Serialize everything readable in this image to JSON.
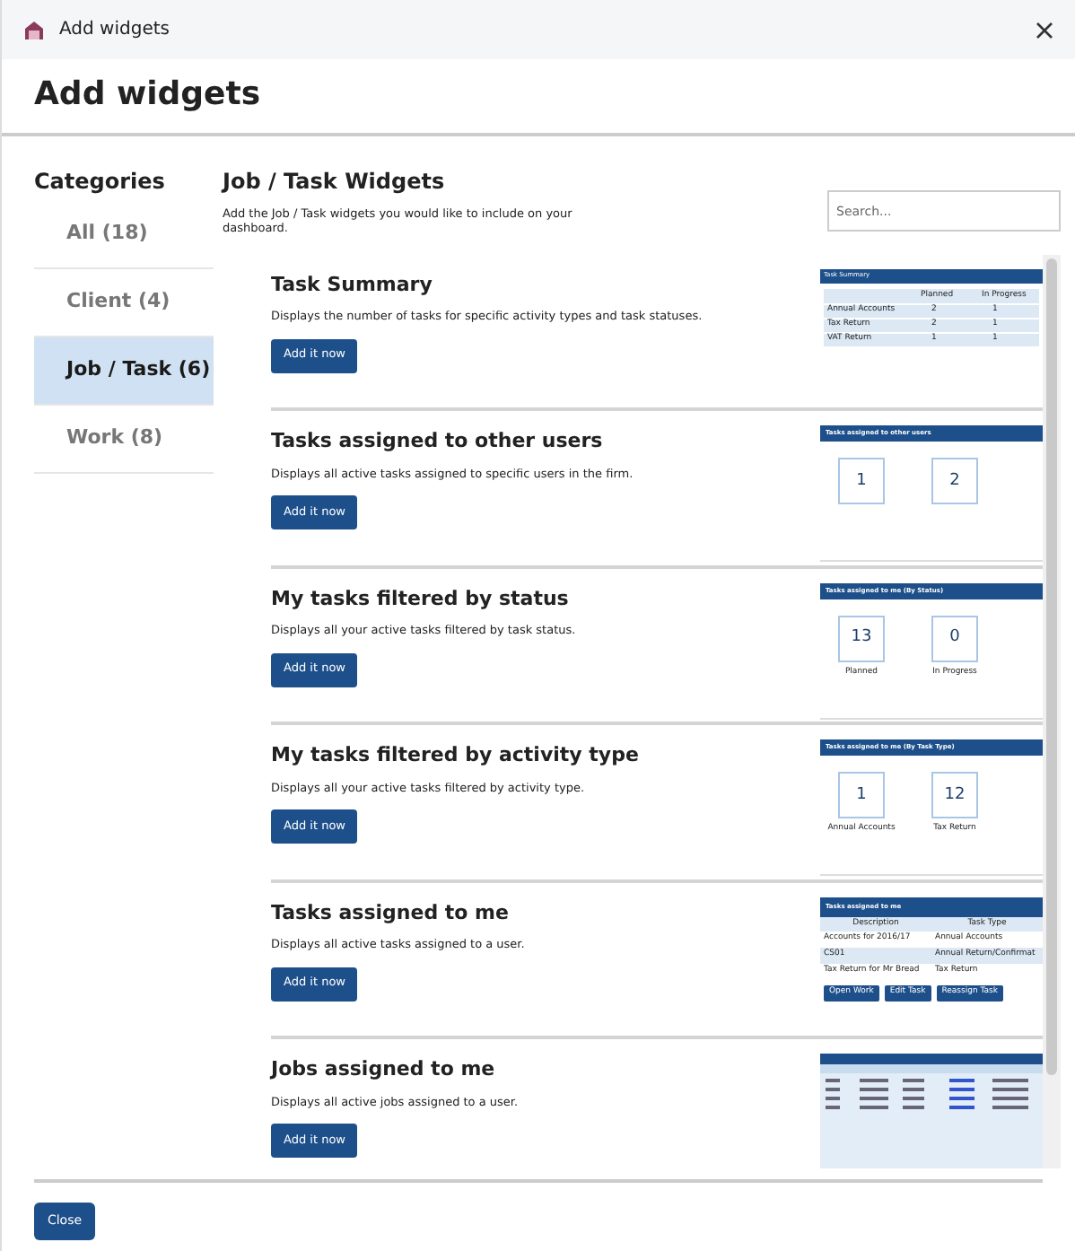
{
  "window": {
    "title": "Add widgets"
  },
  "heading": "Add widgets",
  "sidebar": {
    "title": "Categories",
    "items": [
      {
        "label": "All (18)",
        "selected": false
      },
      {
        "label": "Client (4)",
        "selected": false
      },
      {
        "label": "Job / Task (6)",
        "selected": true
      },
      {
        "label": "Work (8)",
        "selected": false
      }
    ]
  },
  "main": {
    "title": "Job / Task Widgets",
    "description": "Add the Job / Task widgets you would like to include on your dashboard.",
    "search": {
      "placeholder": "Search..."
    }
  },
  "widgets": [
    {
      "title": "Task Summary",
      "description": "Displays the number of tasks for specific activity types and task statuses.",
      "button": "Add it now",
      "preview": {
        "kind": "summary",
        "title": "Task Summary",
        "columns": [
          "",
          "Planned",
          "In Progress"
        ],
        "rows": [
          [
            "Annual Accounts",
            "2",
            "1"
          ],
          [
            "Tax Return",
            "2",
            "1"
          ],
          [
            "VAT Return",
            "1",
            "1"
          ]
        ]
      }
    },
    {
      "title": "Tasks assigned to other users",
      "description": "Displays all active tasks assigned to specific users in the firm.",
      "button": "Add it now",
      "preview": {
        "kind": "tiles",
        "title": "Tasks assigned to other users",
        "tiles": [
          {
            "value": "1"
          },
          {
            "value": "2"
          }
        ]
      }
    },
    {
      "title": "My tasks filtered by status",
      "description": "Displays all your active tasks filtered by task status.",
      "button": "Add it now",
      "preview": {
        "kind": "tiles",
        "title": "Tasks assigned to me (By Status)",
        "tiles": [
          {
            "value": "13",
            "label": "Planned"
          },
          {
            "value": "0",
            "label": "In Progress"
          }
        ]
      }
    },
    {
      "title": "My tasks filtered by activity type",
      "description": "Displays all your active tasks filtered by activity type.",
      "button": "Add it now",
      "preview": {
        "kind": "tiles",
        "title": "Tasks assigned to me (By Task Type)",
        "tiles": [
          {
            "value": "1",
            "label": "Annual Accounts"
          },
          {
            "value": "12",
            "label": "Tax Return"
          }
        ]
      }
    },
    {
      "title": "Tasks assigned to me",
      "description": "Displays all active tasks assigned to a user.",
      "button": "Add it now",
      "preview": {
        "kind": "table",
        "title": "Tasks assigned to me",
        "columns": [
          "Description",
          "Task Type"
        ],
        "rows": [
          [
            "Accounts for 2016/17",
            "Annual Accounts"
          ],
          [
            "CS01",
            "Annual Return/Confirmat"
          ],
          [
            "Tax Return for Mr Bread",
            "Tax Return"
          ]
        ],
        "buttons": [
          "Open Work",
          "Edit Task",
          "Reassign Task"
        ]
      }
    },
    {
      "title": "Jobs assigned to me",
      "description": "Displays all active jobs assigned to a user.",
      "button": "Add it now",
      "preview": {
        "kind": "jobs"
      }
    }
  ],
  "footer": {
    "button": "Close"
  }
}
